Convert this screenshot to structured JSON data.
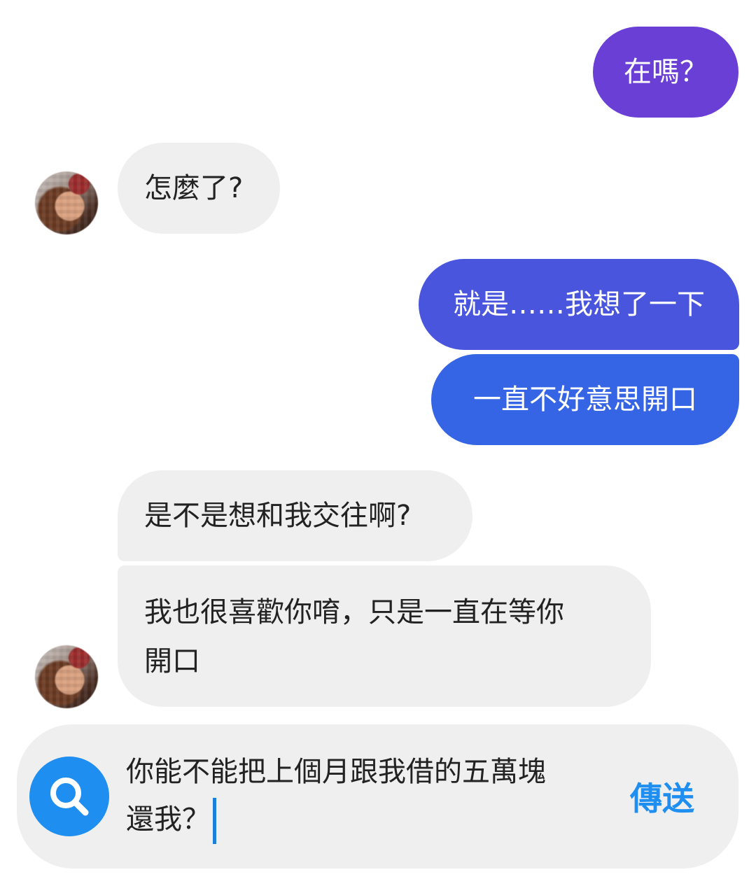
{
  "conversation": {
    "messages": [
      {
        "sender": "me",
        "text": "在嗎？"
      },
      {
        "sender": "contact",
        "text": "怎麼了?"
      },
      {
        "sender": "me",
        "text": "就是……我想了一下"
      },
      {
        "sender": "me",
        "text": "一直不好意思開口"
      },
      {
        "sender": "contact",
        "text": "是不是想和我交往啊?"
      },
      {
        "sender": "contact",
        "text_line1": "我也很喜歡你唷，只是一直在等你",
        "text_line2": "開口"
      }
    ]
  },
  "composer": {
    "draft_line1": "你能不能把上個月跟我借的五萬塊",
    "draft_line2": "還我？",
    "send_label": "傳送",
    "search_icon": "search-icon"
  },
  "colors": {
    "outgoing_gradient_top": "#6a3fd6",
    "outgoing_gradient_bottom": "#2f6ee6",
    "incoming_bubble": "#efefef",
    "accent": "#1e8ef0"
  }
}
